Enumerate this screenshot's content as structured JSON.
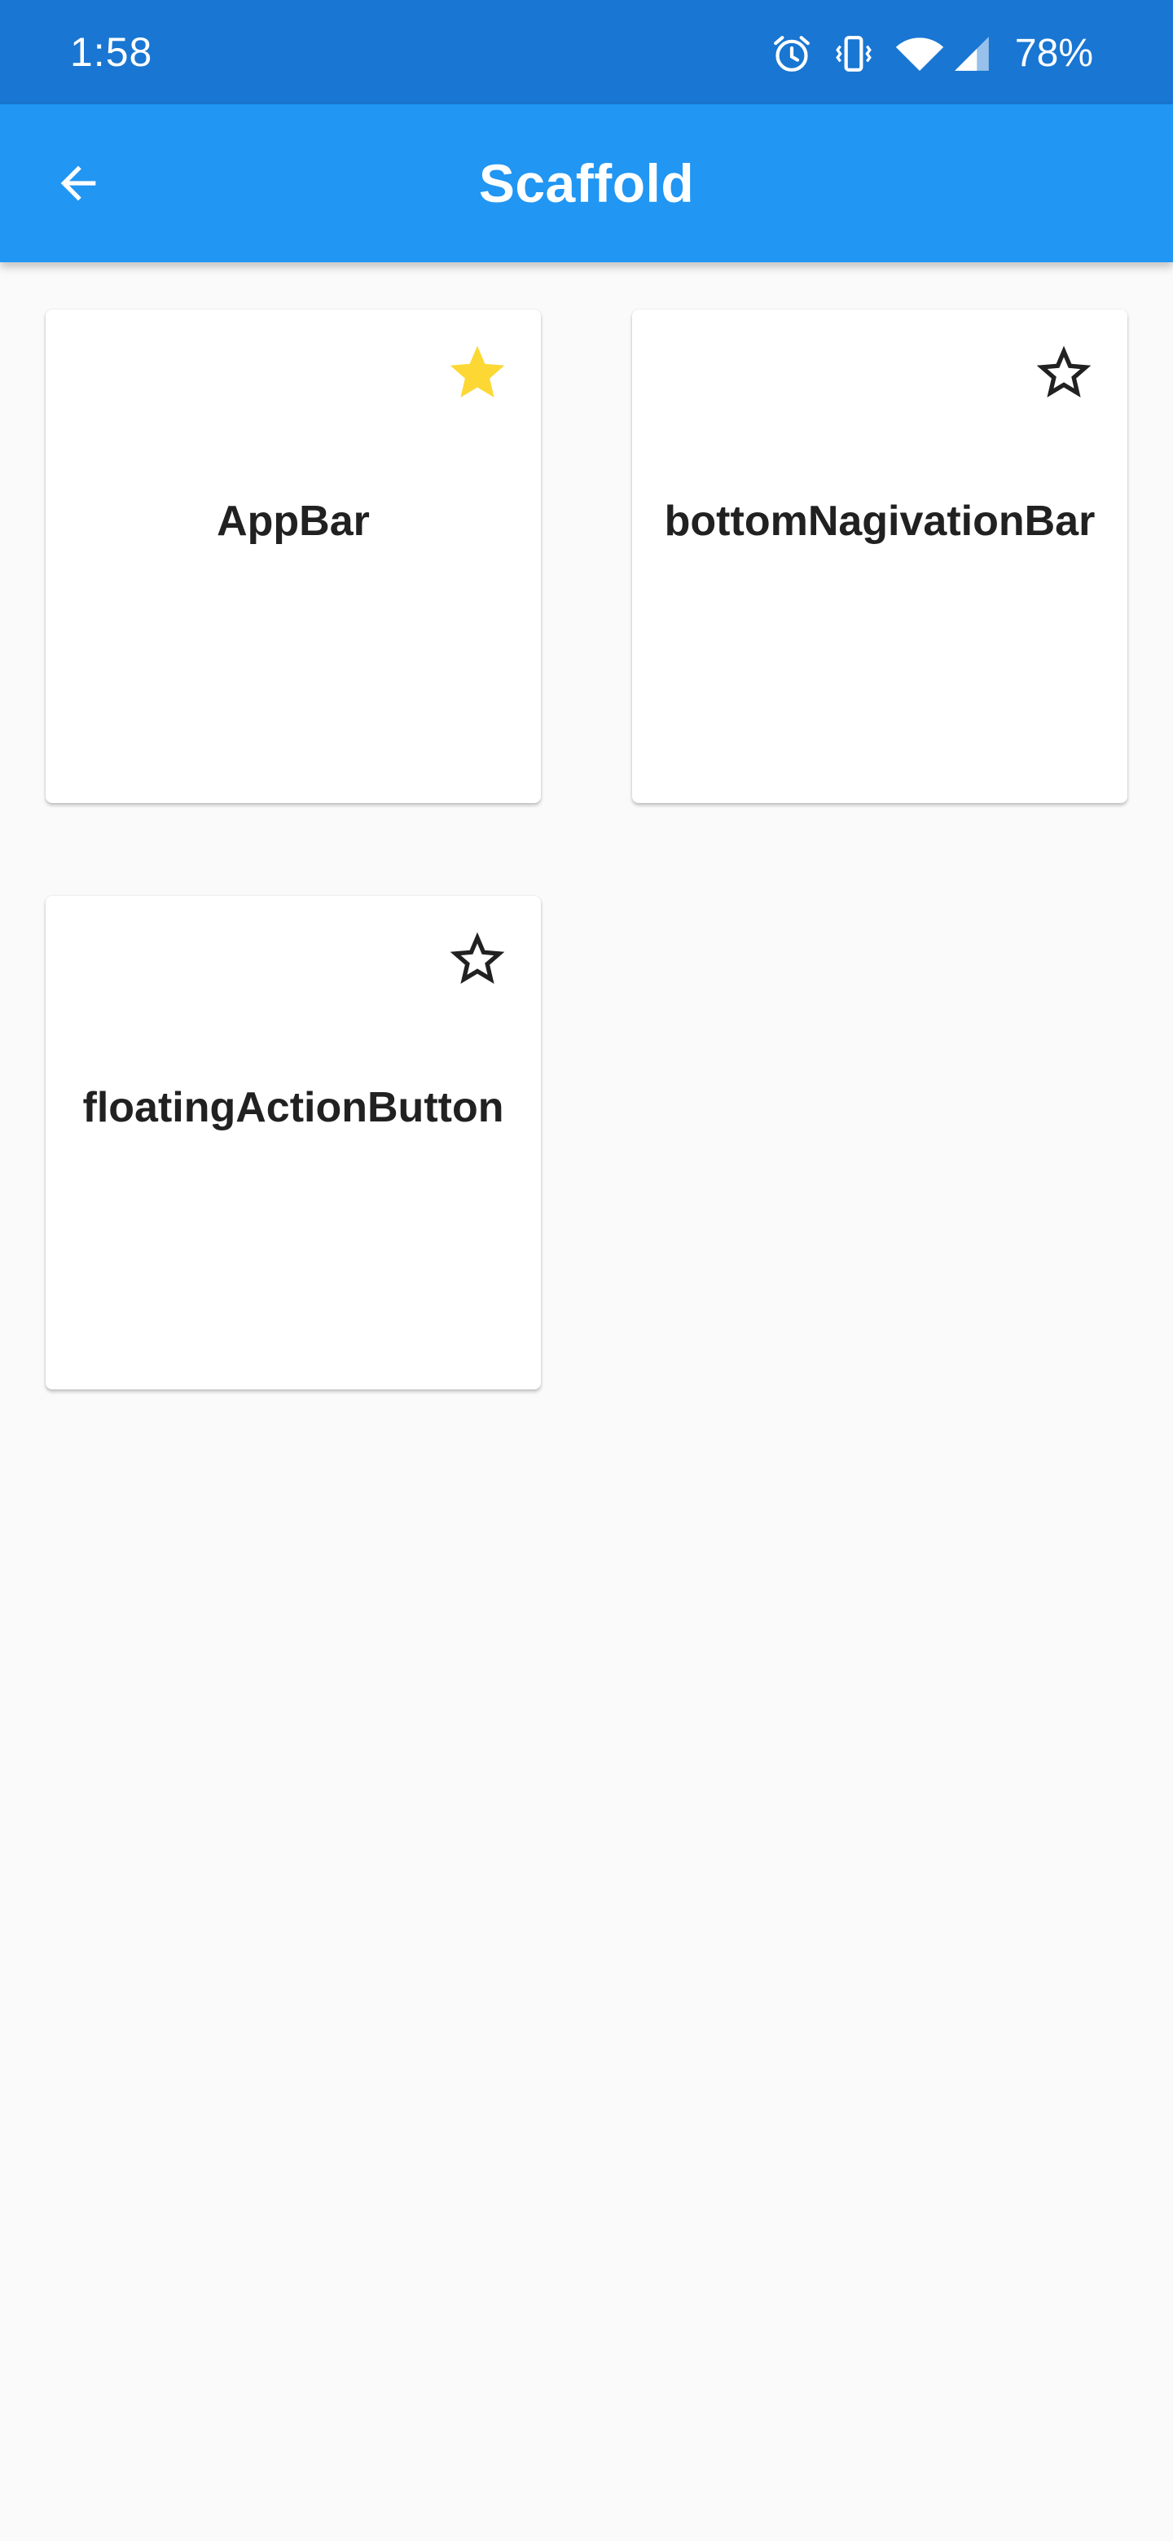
{
  "status_bar": {
    "time": "1:58",
    "battery": "78%",
    "icons": [
      "alarm-icon",
      "vibrate-icon",
      "wifi-icon",
      "signal-icon"
    ]
  },
  "app_bar": {
    "title": "Scaffold",
    "back_icon": "arrow-back-icon",
    "background": "#2196f3"
  },
  "colors": {
    "status_bar": "#1976d2",
    "star_active": "#fdd835",
    "star_inactive": "#212121"
  },
  "cards": [
    {
      "label": "AppBar",
      "favorited": true
    },
    {
      "label": "bottomNagivationBar",
      "favorited": false
    },
    {
      "label": "floatingActionButton",
      "favorited": false
    }
  ]
}
